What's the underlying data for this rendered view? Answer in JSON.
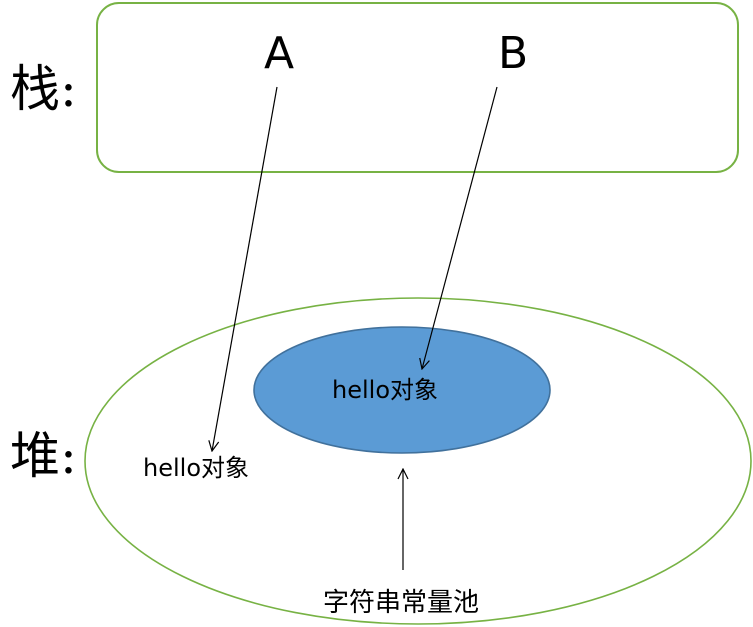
{
  "labels": {
    "stack": "栈:",
    "heap": "堆:"
  },
  "variables": {
    "a": "A",
    "b": "B"
  },
  "objects": {
    "heap_object": "hello对象",
    "pool_object": "hello对象"
  },
  "pool": {
    "label": "字符串常量池"
  },
  "colors": {
    "frame_stroke": "#77b244",
    "pool_fill": "#5b9bd5",
    "pool_stroke": "#41719c"
  }
}
